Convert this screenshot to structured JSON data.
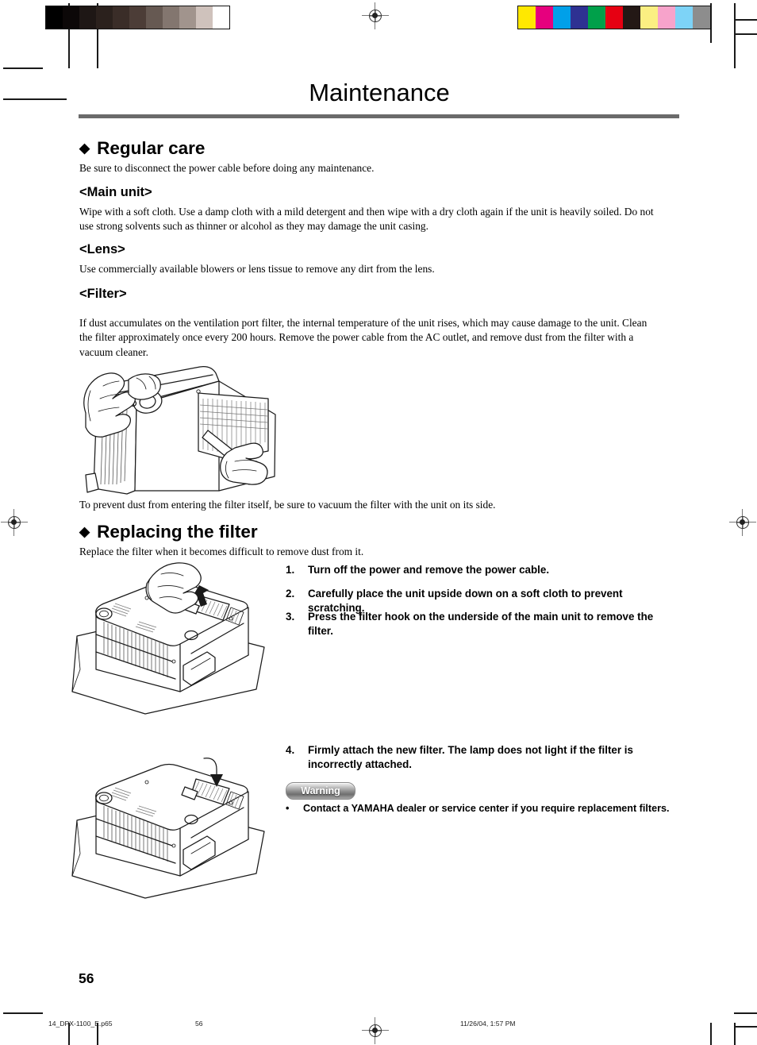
{
  "document": {
    "title": "Maintenance",
    "page_number": "56"
  },
  "sections": {
    "regular_care": {
      "bullet": "◆",
      "heading": "Regular care",
      "intro": "Be sure to disconnect the power cable before doing any maintenance.",
      "main_unit": {
        "heading": "<Main unit>",
        "text": "Wipe with a soft cloth. Use a damp cloth with a mild detergent and then wipe with a dry cloth again if the unit is heavily soiled. Do not use strong solvents such as thinner or alcohol as they may damage the unit casing."
      },
      "lens": {
        "heading": "<Lens>",
        "text": "Use commercially available blowers or lens tissue to remove any dirt from the lens."
      },
      "filter": {
        "heading": "<Filter>",
        "text": "If dust accumulates on the ventilation port filter, the internal temperature of the unit rises, which may cause damage to the unit. Clean the filter approximately once every 200 hours. Remove the power cable from the AC outlet, and remove dust from the filter with a vacuum cleaner."
      },
      "caption_after_figure": "To prevent dust from entering the filter itself, be sure to vacuum the filter with the unit on its side."
    },
    "replacing_the_filter": {
      "bullet": "◆",
      "heading": "Replacing the filter",
      "intro": "Replace the filter when it becomes difficult to remove dust from it.",
      "steps": [
        {
          "num": "1.",
          "text": "Turn off the power and remove the power cable."
        },
        {
          "num": "2.",
          "text": "Carefully place the unit upside down on a soft cloth to prevent scratching."
        },
        {
          "num": "3.",
          "text": "Press the filter hook on the underside of the main unit to remove the filter."
        },
        {
          "num": "4.",
          "text": "Firmly attach the new filter. The lamp does not light if the filter is incorrectly attached."
        }
      ],
      "warning": {
        "label": "Warning",
        "bullet": "•",
        "text": "Contact a YAMAHA dealer or service center if you require replacement filters."
      }
    }
  },
  "figures": {
    "vacuum_filter": "Projector standing on its side with one hand steadying the unit and the other hand holding a vacuum nozzle against the ventilation port filter",
    "unit_upside_down_remove": "Projector placed upside down on a soft cloth with a hand pressing the filter hook on the underside to remove the filter",
    "unit_upside_down_attach": "Projector upside down on a soft cloth with an arrow showing the new filter being pressed into place"
  },
  "prepress": {
    "gray_scale_swatches": [
      "#000000",
      "#0c0808",
      "#1e1715",
      "#2b211d",
      "#3a2d28",
      "#4c3d37",
      "#665952",
      "#83766f",
      "#a1948d",
      "#cfc2bc",
      "#ffffff"
    ],
    "color_swatches": [
      "#ffe800",
      "#e6007e",
      "#00a0e9",
      "#2e3192",
      "#00a04a",
      "#e60012",
      "#231815",
      "#fbef82",
      "#f7a3cb",
      "#7dd3f7",
      "#8d8d8d"
    ],
    "slug_file": "14_DPX-1100_E.p65",
    "slug_page": "56",
    "slug_date": "11/26/04, 1:57 PM"
  }
}
